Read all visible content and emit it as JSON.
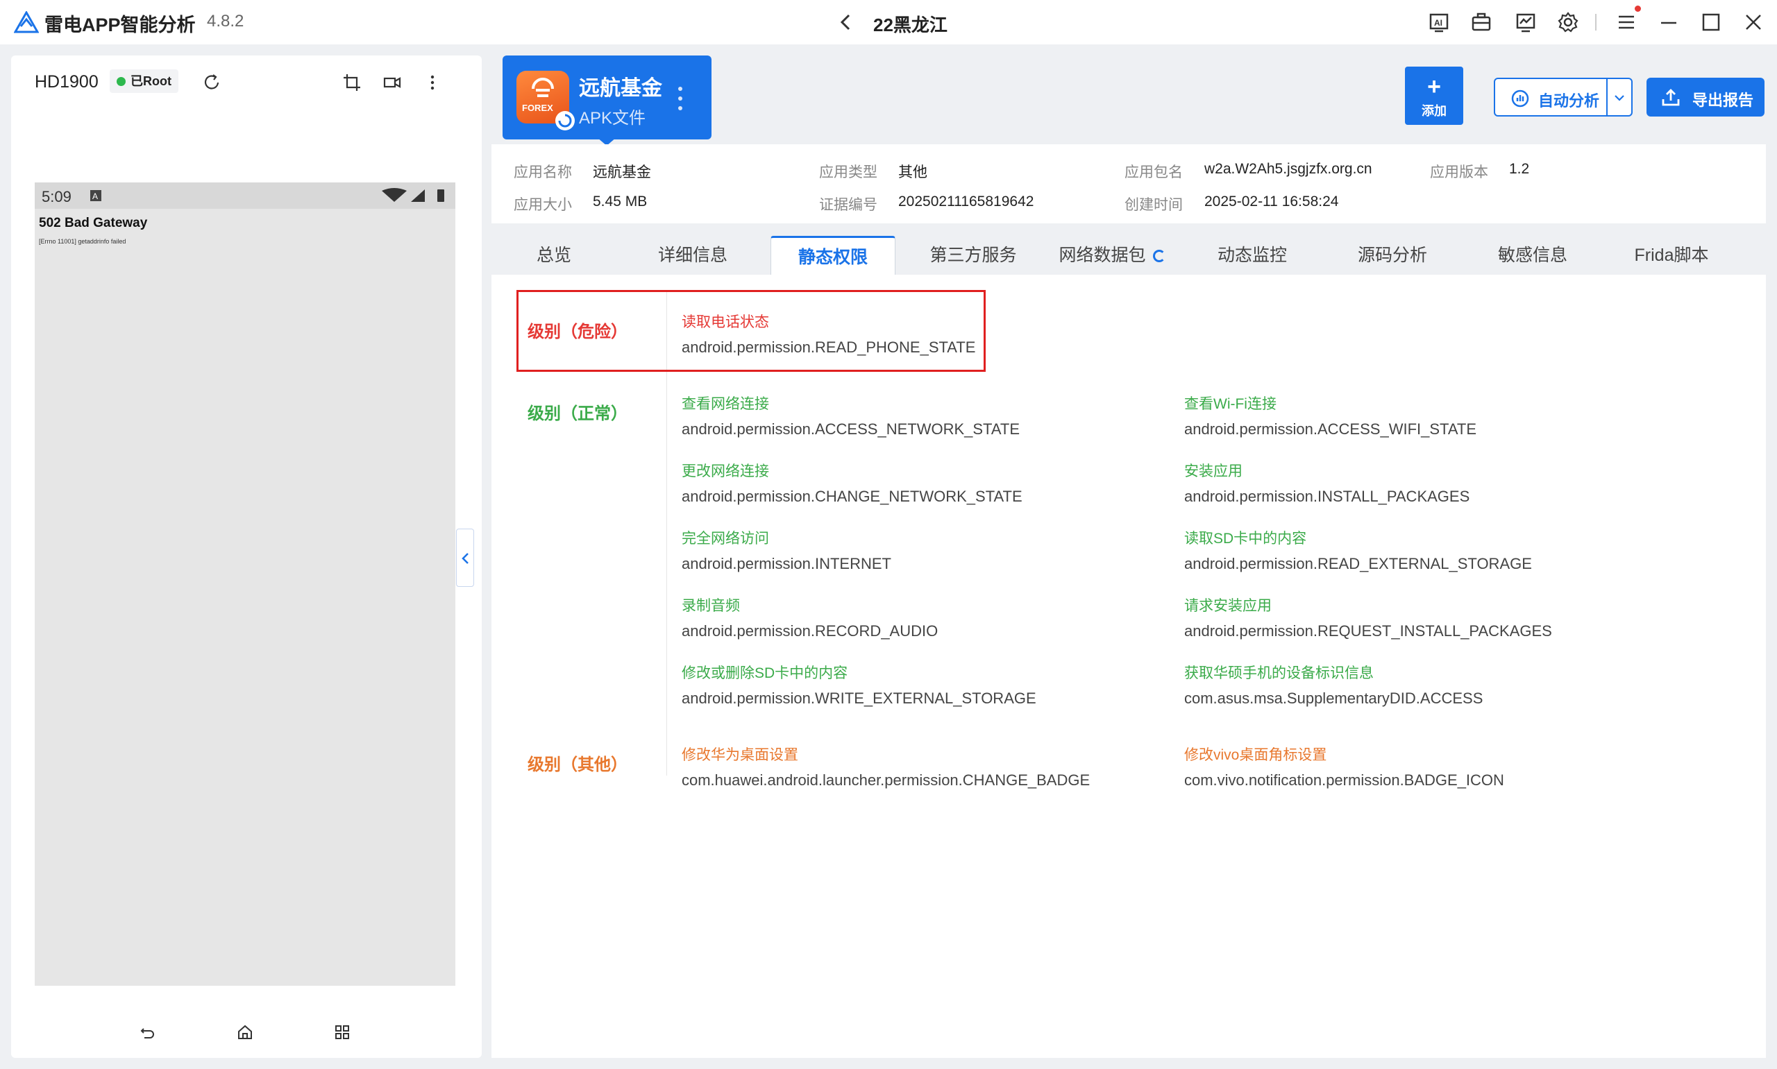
{
  "titlebar": {
    "app_name": "雷电APP智能分析",
    "version": "4.8.2",
    "window_title": "22黑龙江",
    "icons": [
      "ai-icon",
      "toolbox-icon",
      "monitor-icon",
      "settings-gear-icon",
      "menu-icon",
      "minimize-icon",
      "maximize-icon",
      "close-icon"
    ]
  },
  "device": {
    "name": "HD1900",
    "root_status": "已Root",
    "screen": {
      "time": "5:09",
      "error_title": "502 Bad Gateway",
      "error_detail": "[Errno 11001] getaddrinfo failed"
    }
  },
  "app_card": {
    "icon_text": "FOREX",
    "name": "远航基金",
    "type": "APK文件"
  },
  "actions": {
    "add_label": "添加",
    "add_symbol": "+",
    "auto_analysis_label": "自动分析",
    "export_label": "导出报告"
  },
  "info": {
    "app_name_label": "应用名称",
    "app_name_value": "远航基金",
    "app_type_label": "应用类型",
    "app_type_value": "其他",
    "package_label": "应用包名",
    "package_value": "w2a.W2Ah5.jsgjzfx.org.cn",
    "version_label": "应用版本",
    "version_value": "1.2",
    "size_label": "应用大小",
    "size_value": "5.45 MB",
    "cert_label": "证据编号",
    "cert_value": "20250211165819642",
    "created_label": "创建时间",
    "created_value": "2025-02-11 16:58:24"
  },
  "tabs": [
    "总览",
    "详细信息",
    "静态权限",
    "第三方服务",
    "网络数据包",
    "动态监控",
    "源码分析",
    "敏感信息",
    "Frida脚本"
  ],
  "active_tab": "静态权限",
  "levels": {
    "danger": "级别（危险）",
    "normal": "级别（正常）",
    "other": "级别（其他）"
  },
  "permissions": {
    "danger": [
      {
        "name": "读取电话状态",
        "id": "android.permission.READ_PHONE_STATE"
      }
    ],
    "normal": [
      {
        "name": "查看网络连接",
        "id": "android.permission.ACCESS_NETWORK_STATE"
      },
      {
        "name": "查看Wi-Fi连接",
        "id": "android.permission.ACCESS_WIFI_STATE"
      },
      {
        "name": "更改网络连接",
        "id": "android.permission.CHANGE_NETWORK_STATE"
      },
      {
        "name": "安装应用",
        "id": "android.permission.INSTALL_PACKAGES"
      },
      {
        "name": "完全网络访问",
        "id": "android.permission.INTERNET"
      },
      {
        "name": "读取SD卡中的内容",
        "id": "android.permission.READ_EXTERNAL_STORAGE"
      },
      {
        "name": "录制音频",
        "id": "android.permission.RECORD_AUDIO"
      },
      {
        "name": "请求安装应用",
        "id": "android.permission.REQUEST_INSTALL_PACKAGES"
      },
      {
        "name": "修改或删除SD卡中的内容",
        "id": "android.permission.WRITE_EXTERNAL_STORAGE"
      },
      {
        "name": "获取华硕手机的设备标识信息",
        "id": "com.asus.msa.SupplementaryDID.ACCESS"
      }
    ],
    "other": [
      {
        "name": "修改华为桌面设置",
        "id": "com.huawei.android.launcher.permission.CHANGE_BADGE"
      },
      {
        "name": "修改vivo桌面角标设置",
        "id": "com.vivo.notification.permission.BADGE_ICON"
      }
    ]
  },
  "colors": {
    "accent": "#1a73e8",
    "danger": "#e53935",
    "normal": "#3bab4a",
    "other": "#e8782e"
  }
}
